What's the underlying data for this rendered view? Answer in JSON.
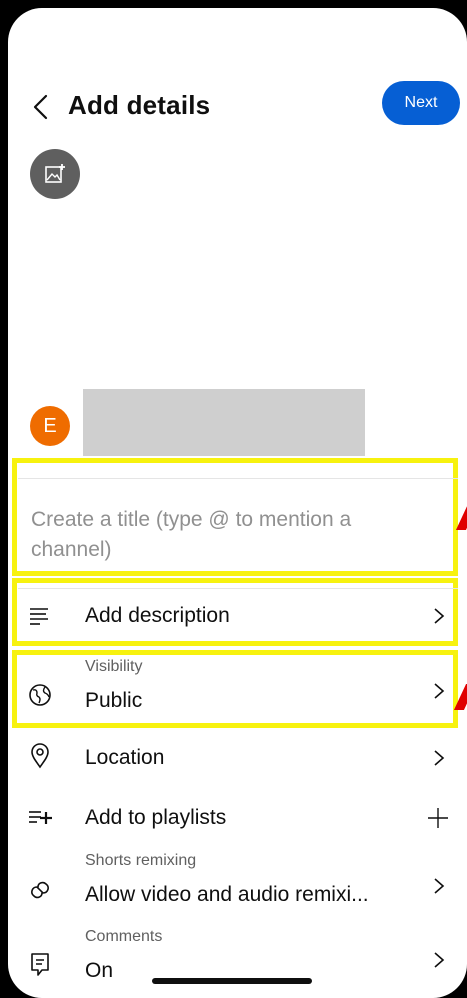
{
  "header": {
    "title": "Add details",
    "next_label": "Next"
  },
  "channel": {
    "avatar_letter": "E"
  },
  "title_field": {
    "placeholder": "Create a title (type @ to mention a channel)"
  },
  "rows": {
    "description": {
      "label": "Add description"
    },
    "visibility": {
      "sublabel": "Visibility",
      "label": "Public"
    },
    "location": {
      "label": "Location"
    },
    "playlists": {
      "label": "Add to playlists"
    },
    "remixing": {
      "sublabel": "Shorts remixing",
      "label": "Allow video and audio remixi..."
    },
    "comments": {
      "sublabel": "Comments",
      "label": "On"
    }
  },
  "colors": {
    "accent": "#065fd4",
    "avatar": "#ef6c00",
    "highlight": "#f7f20f",
    "annotation_arrow": "#e00000"
  }
}
